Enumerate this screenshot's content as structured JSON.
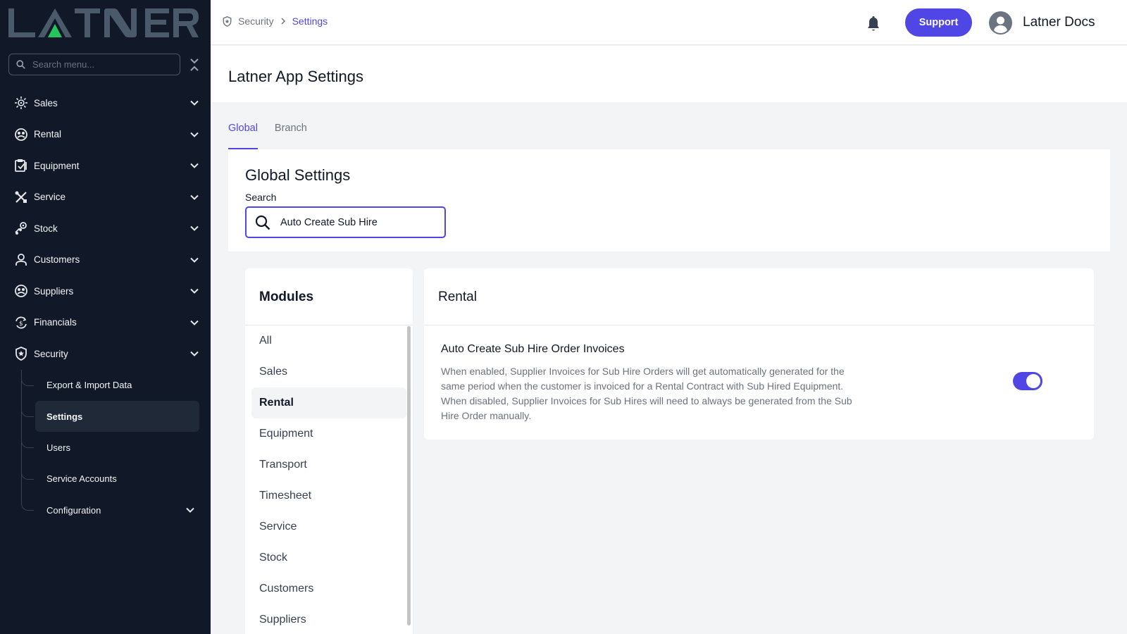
{
  "brand": {
    "logo_text": "LATNER"
  },
  "sidebar": {
    "search_placeholder": "Search menu...",
    "items": [
      {
        "label": "Sales",
        "icon": "sales-icon"
      },
      {
        "label": "Rental",
        "icon": "rental-icon"
      },
      {
        "label": "Equipment",
        "icon": "equipment-icon"
      },
      {
        "label": "Service",
        "icon": "service-icon"
      },
      {
        "label": "Stock",
        "icon": "stock-icon"
      },
      {
        "label": "Customers",
        "icon": "customers-icon"
      },
      {
        "label": "Suppliers",
        "icon": "suppliers-icon"
      },
      {
        "label": "Financials",
        "icon": "financials-icon"
      },
      {
        "label": "Security",
        "icon": "shield-icon"
      }
    ],
    "security_sub": [
      {
        "label": "Export & Import Data"
      },
      {
        "label": "Settings",
        "active": true
      },
      {
        "label": "Users"
      },
      {
        "label": "Service Accounts"
      },
      {
        "label": "Configuration"
      }
    ]
  },
  "topbar": {
    "breadcrumb": [
      "Security",
      "Settings"
    ],
    "support_label": "Support",
    "user_name": "Latner Docs"
  },
  "page": {
    "title": "Latner App Settings",
    "tabs": [
      "Global",
      "Branch"
    ],
    "active_tab": "Global"
  },
  "global_settings": {
    "heading": "Global Settings",
    "search_label": "Search",
    "search_value": "Auto Create Sub Hire"
  },
  "modules": {
    "heading": "Modules",
    "items": [
      "All",
      "Sales",
      "Rental",
      "Equipment",
      "Transport",
      "Timesheet",
      "Service",
      "Stock",
      "Customers",
      "Suppliers"
    ],
    "active": "Rental"
  },
  "rental_panel": {
    "heading": "Rental",
    "setting_title": "Auto Create Sub Hire Order Invoices",
    "setting_description": "When enabled, Supplier Invoices for Sub Hire Orders will get automatically generated for the same period when the customer is invoiced for a Rental Contract with Sub Hired Equipment. When disabled, Supplier Invoices for Sub Hires will need to always be generated from the Sub Hire Order manually.",
    "toggle_on": true
  },
  "colors": {
    "sidebar_bg": "#111827",
    "accent": "#4f46e5",
    "logo_gray": "#4b5a6b",
    "logo_green": "#22c55e"
  }
}
